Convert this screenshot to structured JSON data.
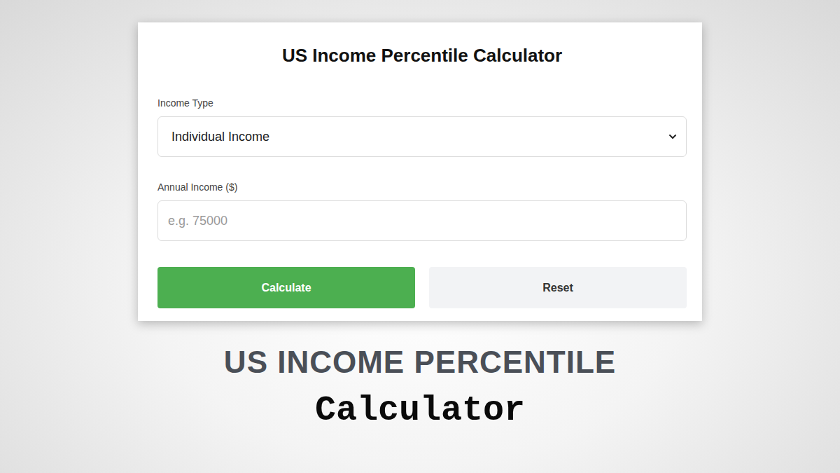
{
  "card": {
    "title": "US Income Percentile Calculator",
    "fields": [
      {
        "label": "Income Type",
        "kind": "select",
        "value": "Individual Income"
      },
      {
        "label": "Annual Income ($)",
        "kind": "input",
        "placeholder": "e.g. 75000"
      }
    ],
    "buttons": [
      {
        "label": "Calculate",
        "kind": "primary"
      },
      {
        "label": "Reset",
        "kind": "secondary"
      }
    ]
  },
  "headline": "US INCOME PERCENTILE",
  "subheadline": "Calculator"
}
